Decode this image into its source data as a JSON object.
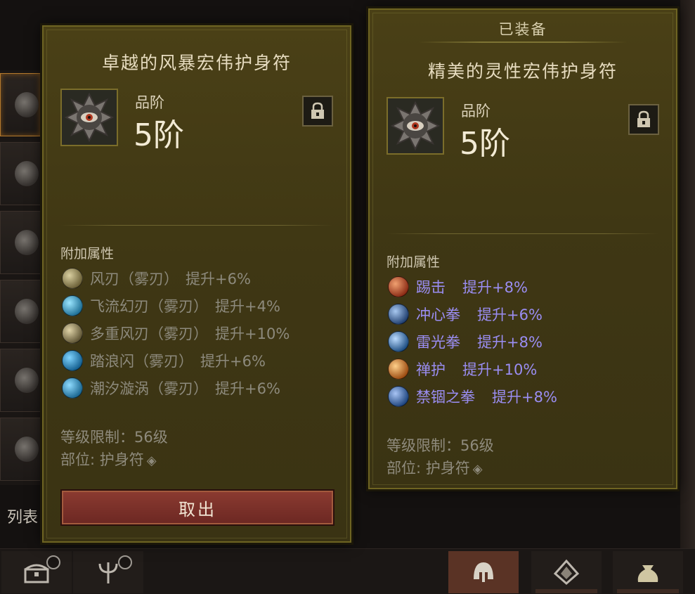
{
  "background": {
    "list_label": "列表"
  },
  "panel_left": {
    "title": "卓越的风暴宏伟护身符",
    "grade_label": "品阶",
    "grade_value": "5阶",
    "section_title": "附加属性",
    "attributes": [
      {
        "skill": "风刃（雾刃）",
        "boost": "提升+6%",
        "icon": "wind-blade-icon",
        "color": "#9c8f5e"
      },
      {
        "skill": "飞流幻刃（雾刃）",
        "boost": "提升+4%",
        "icon": "flying-blade-icon",
        "color": "#4aa6c8"
      },
      {
        "skill": "多重风刃（雾刃）",
        "boost": "提升+10%",
        "icon": "multi-wind-blade-icon",
        "color": "#a49566"
      },
      {
        "skill": "踏浪闪（雾刃）",
        "boost": "提升+6%",
        "icon": "wave-dash-icon",
        "color": "#2f8fc0"
      },
      {
        "skill": "潮汐漩涡（雾刃）",
        "boost": "提升+6%",
        "icon": "tidal-vortex-icon",
        "color": "#3b9dc8"
      }
    ],
    "level_req": "等级限制：56级",
    "slot_info": "部位: 护身符",
    "take_out_button": "取出"
  },
  "panel_right": {
    "equipped_label": "已装备",
    "title": "精美的灵性宏伟护身符",
    "grade_label": "品阶",
    "grade_value": "5阶",
    "section_title": "附加属性",
    "attributes": [
      {
        "skill": "踢击",
        "boost": "提升+8%",
        "icon": "kick-icon",
        "color": "#c8552e"
      },
      {
        "skill": "冲心拳",
        "boost": "提升+6%",
        "icon": "heart-punch-icon",
        "color": "#3d6fa8"
      },
      {
        "skill": "雷光拳",
        "boost": "提升+8%",
        "icon": "thunder-punch-icon",
        "color": "#3f7fb8"
      },
      {
        "skill": "禅护",
        "boost": "提升+10%",
        "icon": "zen-guard-icon",
        "color": "#d07a2a"
      },
      {
        "skill": "禁锢之拳",
        "boost": "提升+8%",
        "icon": "binding-fist-icon",
        "color": "#3a6fb0"
      }
    ],
    "level_req": "等级限制：56级",
    "slot_info": "部位: 护身符"
  },
  "bottom_tabs": [
    {
      "icon": "chest-icon"
    },
    {
      "icon": "trident-icon"
    },
    {
      "icon": "helmet-icon"
    },
    {
      "icon": "gem-icon"
    },
    {
      "icon": "bag-icon"
    }
  ]
}
